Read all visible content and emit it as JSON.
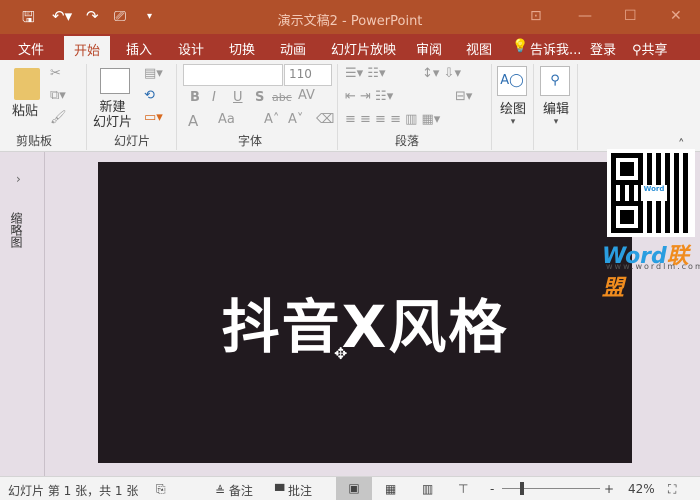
{
  "titlebar": {
    "title": "演示文稿2 - PowerPoint",
    "icons": [
      "save-icon",
      "undo-icon",
      "redo-icon",
      "present-from-start-icon",
      "customize-qat-icon"
    ],
    "window_icons": [
      "ribbon-display-icon",
      "minimize-icon",
      "maximize-icon",
      "close-icon"
    ]
  },
  "tabs": [
    "文件",
    "开始",
    "插入",
    "设计",
    "切换",
    "动画",
    "幻灯片放映",
    "审阅",
    "视图"
  ],
  "active_tab": "开始",
  "tell_me": "告诉我...",
  "login": "登录",
  "share": "共享",
  "ribbon": {
    "clipboard": {
      "label": "剪贴板",
      "paste": "粘贴"
    },
    "slides": {
      "label": "幻灯片",
      "new_slide_1": "新建",
      "new_slide_2": "幻灯片"
    },
    "font": {
      "label": "字体",
      "font_name": "",
      "font_size": "110",
      "bold": "B",
      "italic": "I",
      "underline": "U",
      "shadow": "S",
      "strike": "abc",
      "spacing": "AV",
      "color": "A",
      "case": "Aa"
    },
    "paragraph": {
      "label": "段落"
    },
    "drawing": {
      "label": "绘图"
    },
    "editing": {
      "label": "编辑"
    }
  },
  "thumbnail_pane": {
    "label": "缩略图"
  },
  "slide": {
    "title": "抖音X风格",
    "background": "#211a1f"
  },
  "watermark": {
    "brand": "Word",
    "brand_cn": "联盟",
    "url": "www.wordlm.com"
  },
  "status": {
    "slide_info": "幻灯片 第 1 张，共 1 张",
    "notes": "备注",
    "comments": "批注",
    "zoom": "42%",
    "zoom_level": 42
  },
  "colors": {
    "titlebar": "#b1502a",
    "tabbar": "#a8382b",
    "ribbon": "#f3f3f3",
    "workspace": "#e6dee6"
  }
}
